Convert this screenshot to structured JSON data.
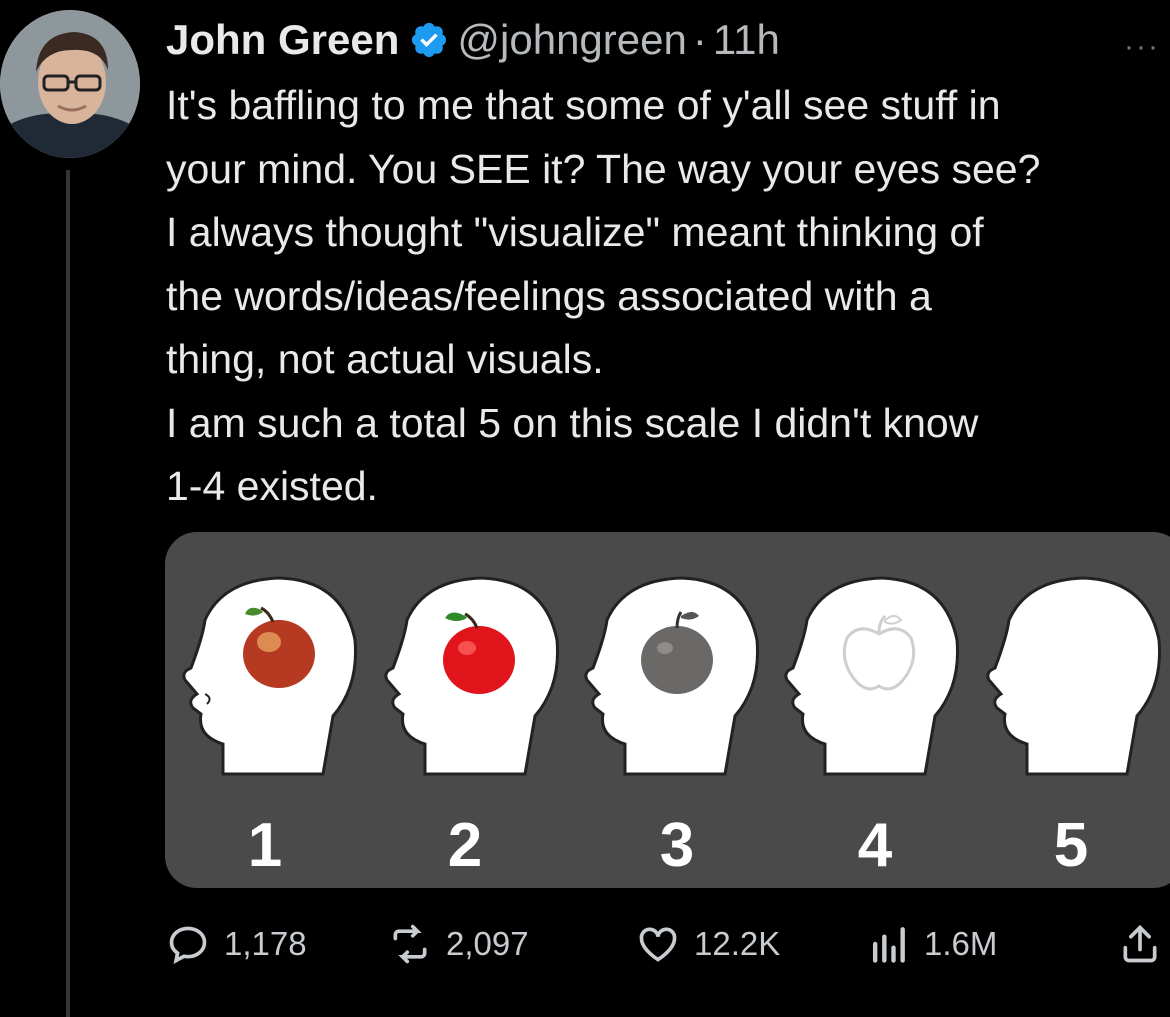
{
  "tweet": {
    "author_name": "John Green",
    "handle": "@johngreen",
    "separator": "·",
    "time": "11h",
    "more": "···",
    "lines": [
      "It's baffling to me that some of y'all see stuff in",
      "your mind. You SEE it? The way your eyes see?",
      "I always thought \"visualize\" meant thinking of",
      "the words/ideas/feelings associated with a",
      "thing, not actual visuals.",
      "I am such a total 5 on this scale I didn't know",
      "1-4 existed."
    ]
  },
  "media": {
    "scale_labels": [
      "1",
      "2",
      "3",
      "4",
      "5"
    ],
    "head_images": [
      "realistic-apple",
      "red-apple",
      "gray-apple",
      "outline-apple",
      "empty"
    ]
  },
  "actions": {
    "replies": "1,178",
    "reposts": "2,097",
    "likes": "12.2K",
    "views": "1.6M"
  },
  "colors": {
    "background": "#000000",
    "text": "#e7e9ea",
    "muted": "#71767b",
    "verified": "#1d9bf0",
    "media_bg": "#4a4a4a"
  },
  "icons": [
    "verified-badge-icon",
    "more-icon",
    "reply-icon",
    "repost-icon",
    "like-icon",
    "views-icon",
    "share-icon"
  ]
}
